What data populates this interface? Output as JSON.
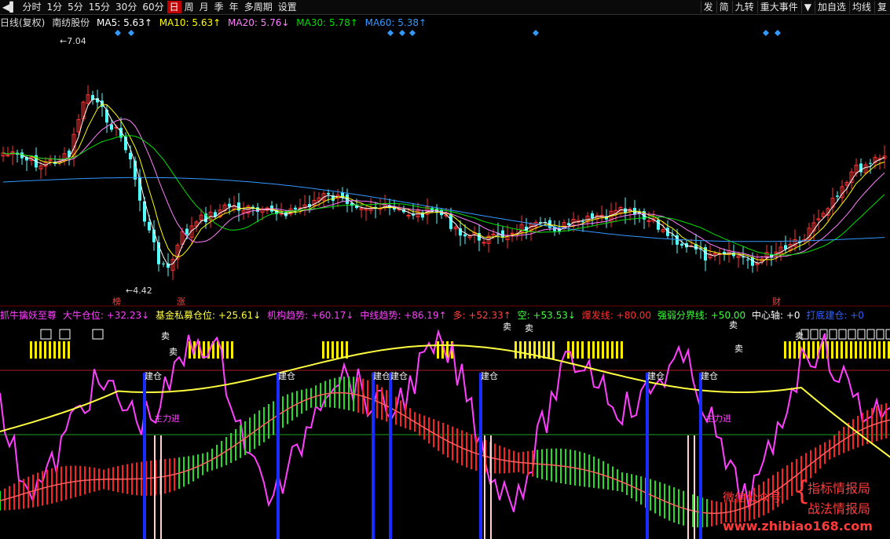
{
  "toolbar": {
    "arrow_icon": "play-back-icon",
    "periods": [
      "分时",
      "1分",
      "5分",
      "15分",
      "30分",
      "60分",
      "日",
      "周",
      "月",
      "季",
      "年",
      "多周期",
      "设置"
    ],
    "active_period": "日",
    "right_items": [
      "发",
      "简",
      "九转",
      "重大事件",
      "▼",
      "加自选",
      "均线",
      "复"
    ]
  },
  "chart_info": {
    "label": "日线(复权)",
    "stock": "南纺股份",
    "ma5": "MA5: 5.63↑",
    "ma10": "MA10: 5.63↑",
    "ma20": "MA20: 5.76↓",
    "ma30": "MA30: 5.78↑",
    "ma60": "MA60: 5.38↑"
  },
  "price_annotations": {
    "high": "7.04",
    "low": "4.42",
    "marker1": "榜",
    "marker2": "涨",
    "marker3": "财"
  },
  "indicator": {
    "name": "抓牛擒妖至尊",
    "bull": "大牛仓位: +32.23↓",
    "fund": "基金私募仓位: +25.61↓",
    "inst": "机构趋势: +60.17↓",
    "mid": "中线趋势: +86.19↑",
    "long": "多: +52.33↑",
    "short": "空: +53.53↓",
    "burst": "爆发线: +80.00",
    "strength": "强弱分界线: +50.00",
    "axis": "中心轴: +0",
    "bottom": "打底建仓: +0"
  },
  "indicator_labels": {
    "build": "建仓",
    "sell": "卖",
    "main_in": "主力进"
  },
  "watermark": {
    "left": "微信公众号",
    "r1": "指标情报局",
    "r2": "战法情报局",
    "url": "www.zhibiao168.com"
  },
  "colors": {
    "up": "#ff3232",
    "down": "#54ffff",
    "ma5": "#ffffff",
    "ma10": "#ffff00",
    "ma20": "#ff80ff",
    "ma30": "#00e000",
    "ma60": "#3399ff",
    "magenta": "#ff40ff",
    "yellow_line": "#ffff40",
    "build_bar": "#1a2cff",
    "accent": "#c00000"
  }
}
